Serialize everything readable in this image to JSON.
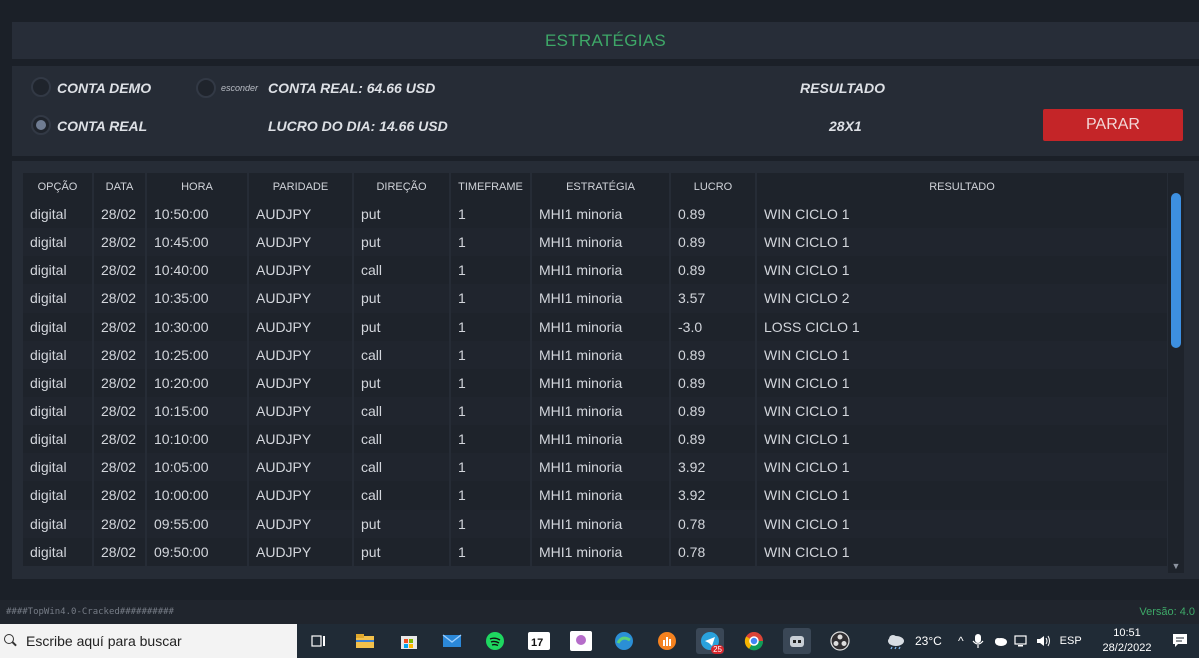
{
  "header": {
    "title": "ESTRATÉGIAS"
  },
  "account": {
    "demo_label": "CONTA DEMO",
    "real_label": "CONTA REAL",
    "hide_label": "esconder",
    "balance_label": "CONTA REAL: 64.66 USD",
    "profit_label": "LUCRO DO DIA: 14.66 USD",
    "result_label": "RESULTADO",
    "result_value": "28X1",
    "stop_button": "PARAR"
  },
  "table": {
    "columns": [
      "OPÇÃO",
      "DATA",
      "HORA",
      "PARIDADE",
      "DIREÇÃO",
      "TIMEFRAME",
      "ESTRATÉGIA",
      "LUCRO",
      "RESULTADO"
    ],
    "rows": [
      [
        "digital",
        "28/02",
        "10:50:00",
        "AUDJPY",
        "put",
        "1",
        "MHI1 minoria",
        "0.89",
        "WIN CICLO 1"
      ],
      [
        "digital",
        "28/02",
        "10:45:00",
        "AUDJPY",
        "put",
        "1",
        "MHI1 minoria",
        "0.89",
        "WIN CICLO 1"
      ],
      [
        "digital",
        "28/02",
        "10:40:00",
        "AUDJPY",
        "call",
        "1",
        "MHI1 minoria",
        "0.89",
        "WIN CICLO 1"
      ],
      [
        "digital",
        "28/02",
        "10:35:00",
        "AUDJPY",
        "put",
        "1",
        "MHI1 minoria",
        "3.57",
        "WIN CICLO 2"
      ],
      [
        "digital",
        "28/02",
        "10:30:00",
        "AUDJPY",
        "put",
        "1",
        "MHI1 minoria",
        "-3.0",
        "LOSS CICLO 1"
      ],
      [
        "digital",
        "28/02",
        "10:25:00",
        "AUDJPY",
        "call",
        "1",
        "MHI1 minoria",
        "0.89",
        "WIN CICLO 1"
      ],
      [
        "digital",
        "28/02",
        "10:20:00",
        "AUDJPY",
        "put",
        "1",
        "MHI1 minoria",
        "0.89",
        "WIN CICLO 1"
      ],
      [
        "digital",
        "28/02",
        "10:15:00",
        "AUDJPY",
        "call",
        "1",
        "MHI1 minoria",
        "0.89",
        "WIN CICLO 1"
      ],
      [
        "digital",
        "28/02",
        "10:10:00",
        "AUDJPY",
        "call",
        "1",
        "MHI1 minoria",
        "0.89",
        "WIN CICLO 1"
      ],
      [
        "digital",
        "28/02",
        "10:05:00",
        "AUDJPY",
        "call",
        "1",
        "MHI1 minoria",
        "3.92",
        "WIN CICLO 1"
      ],
      [
        "digital",
        "28/02",
        "10:00:00",
        "AUDJPY",
        "call",
        "1",
        "MHI1 minoria",
        "3.92",
        "WIN CICLO 1"
      ],
      [
        "digital",
        "28/02",
        "09:55:00",
        "AUDJPY",
        "put",
        "1",
        "MHI1 minoria",
        "0.78",
        "WIN CICLO 1"
      ],
      [
        "digital",
        "28/02",
        "09:50:00",
        "AUDJPY",
        "put",
        "1",
        "MHI1 minoria",
        "0.78",
        "WIN CICLO 1"
      ]
    ]
  },
  "footer": {
    "left": "####TopWin4.0-Cracked##########",
    "version": "Versão: 4.0"
  },
  "taskbar": {
    "search_placeholder": "Escribe aquí para buscar",
    "badge": "25",
    "temperature": "23°C",
    "language": "ESP",
    "time": "10:51",
    "date": "28/2/2022"
  },
  "colors": {
    "accent_green": "#3ea868",
    "stop_red": "#c42528",
    "scroll_blue": "#3d8fe0"
  }
}
